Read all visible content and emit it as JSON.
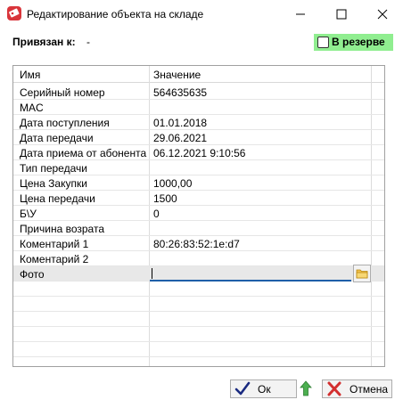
{
  "window": {
    "title": "Редактирование объекта на складе"
  },
  "binding": {
    "label": "Привязан к:",
    "value": "-"
  },
  "reserve": {
    "label": "В резерве",
    "checked": false,
    "bg_color": "#90ee90"
  },
  "grid": {
    "header_name": "Имя",
    "header_value": "Значение",
    "rows": [
      {
        "name": "Серийный номер",
        "value": "564635635"
      },
      {
        "name": "MAC",
        "value": ""
      },
      {
        "name": "Дата поступления",
        "value": "01.01.2018"
      },
      {
        "name": "Дата передачи",
        "value": "29.06.2021"
      },
      {
        "name": "Дата приема от абонента",
        "value": "06.12.2021 9:10:56"
      },
      {
        "name": "Тип передачи",
        "value": ""
      },
      {
        "name": "Цена Закупки",
        "value": "1000,00"
      },
      {
        "name": "Цена передачи",
        "value": "1500"
      },
      {
        "name": "Б\\У",
        "value": "0"
      },
      {
        "name": "Причина возрата",
        "value": ""
      },
      {
        "name": "Коментарий 1",
        "value": "80:26:83:52:1e:d7"
      },
      {
        "name": "Коментарий 2",
        "value": ""
      },
      {
        "name": "Фото",
        "value": ""
      }
    ]
  },
  "buttons": {
    "ok": "Ок",
    "cancel": "Отмена"
  },
  "icons": {
    "app": "app-icon",
    "minimize": "minimize-icon",
    "maximize": "maximize-icon",
    "close": "close-icon",
    "folder": "folder-icon",
    "ok": "checkmark-icon",
    "cancel": "cross-icon",
    "up": "up-arrow-icon"
  }
}
